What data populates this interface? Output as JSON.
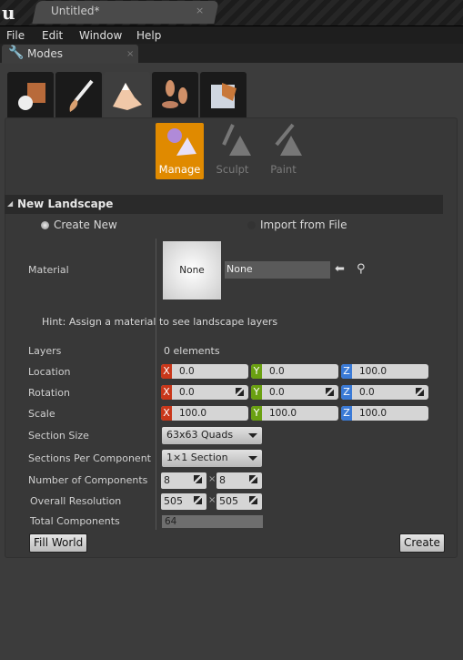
{
  "titlebar": {
    "tab_title": "Untitled*",
    "close": "×"
  },
  "menu": [
    "File",
    "Edit",
    "Window",
    "Help"
  ],
  "modes_tab": {
    "label": "Modes",
    "close": "×"
  },
  "mode_icons": [
    "place-mode-icon",
    "paint-mode-icon",
    "landscape-mode-icon",
    "foliage-mode-icon",
    "geometry-mode-icon"
  ],
  "tools": [
    {
      "label": "Manage"
    },
    {
      "label": "Sculpt"
    },
    {
      "label": "Paint"
    }
  ],
  "section": {
    "title": "New Landscape",
    "arrow": "◢"
  },
  "source": {
    "create_new": "Create New",
    "import": "Import from File"
  },
  "material": {
    "label": "Material",
    "thumb": "None",
    "value": "None"
  },
  "hint": "Hint: Assign a material to see landscape layers",
  "layers": {
    "label": "Layers",
    "value": "0 elements"
  },
  "location": {
    "label": "Location",
    "x": "0.0",
    "y": "0.0",
    "z": "100.0"
  },
  "rotation": {
    "label": "Rotation",
    "x": "0.0",
    "y": "0.0",
    "z": "0.0"
  },
  "scale": {
    "label": "Scale",
    "x": "100.0",
    "y": "100.0",
    "z": "100.0"
  },
  "axes": {
    "x": "X",
    "y": "Y",
    "z": "Z"
  },
  "section_size": {
    "label": "Section Size",
    "value": "63x63 Quads"
  },
  "sections_per_component": {
    "label": "Sections Per Component",
    "value": "1×1 Section"
  },
  "num_components": {
    "label": "Number of Components",
    "x": "8",
    "y": "8",
    "sep": "×"
  },
  "overall_resolution": {
    "label": "Overall Resolution",
    "x": "505",
    "y": "505",
    "sep": "×"
  },
  "total_components": {
    "label": "Total Components",
    "value": "64"
  },
  "buttons": {
    "fill_world": "Fill World",
    "create": "Create"
  },
  "colors": {
    "accent": "#e08a00",
    "x_axis": "#c8371a",
    "y_axis": "#6aa011",
    "z_axis": "#3a7ad6"
  }
}
